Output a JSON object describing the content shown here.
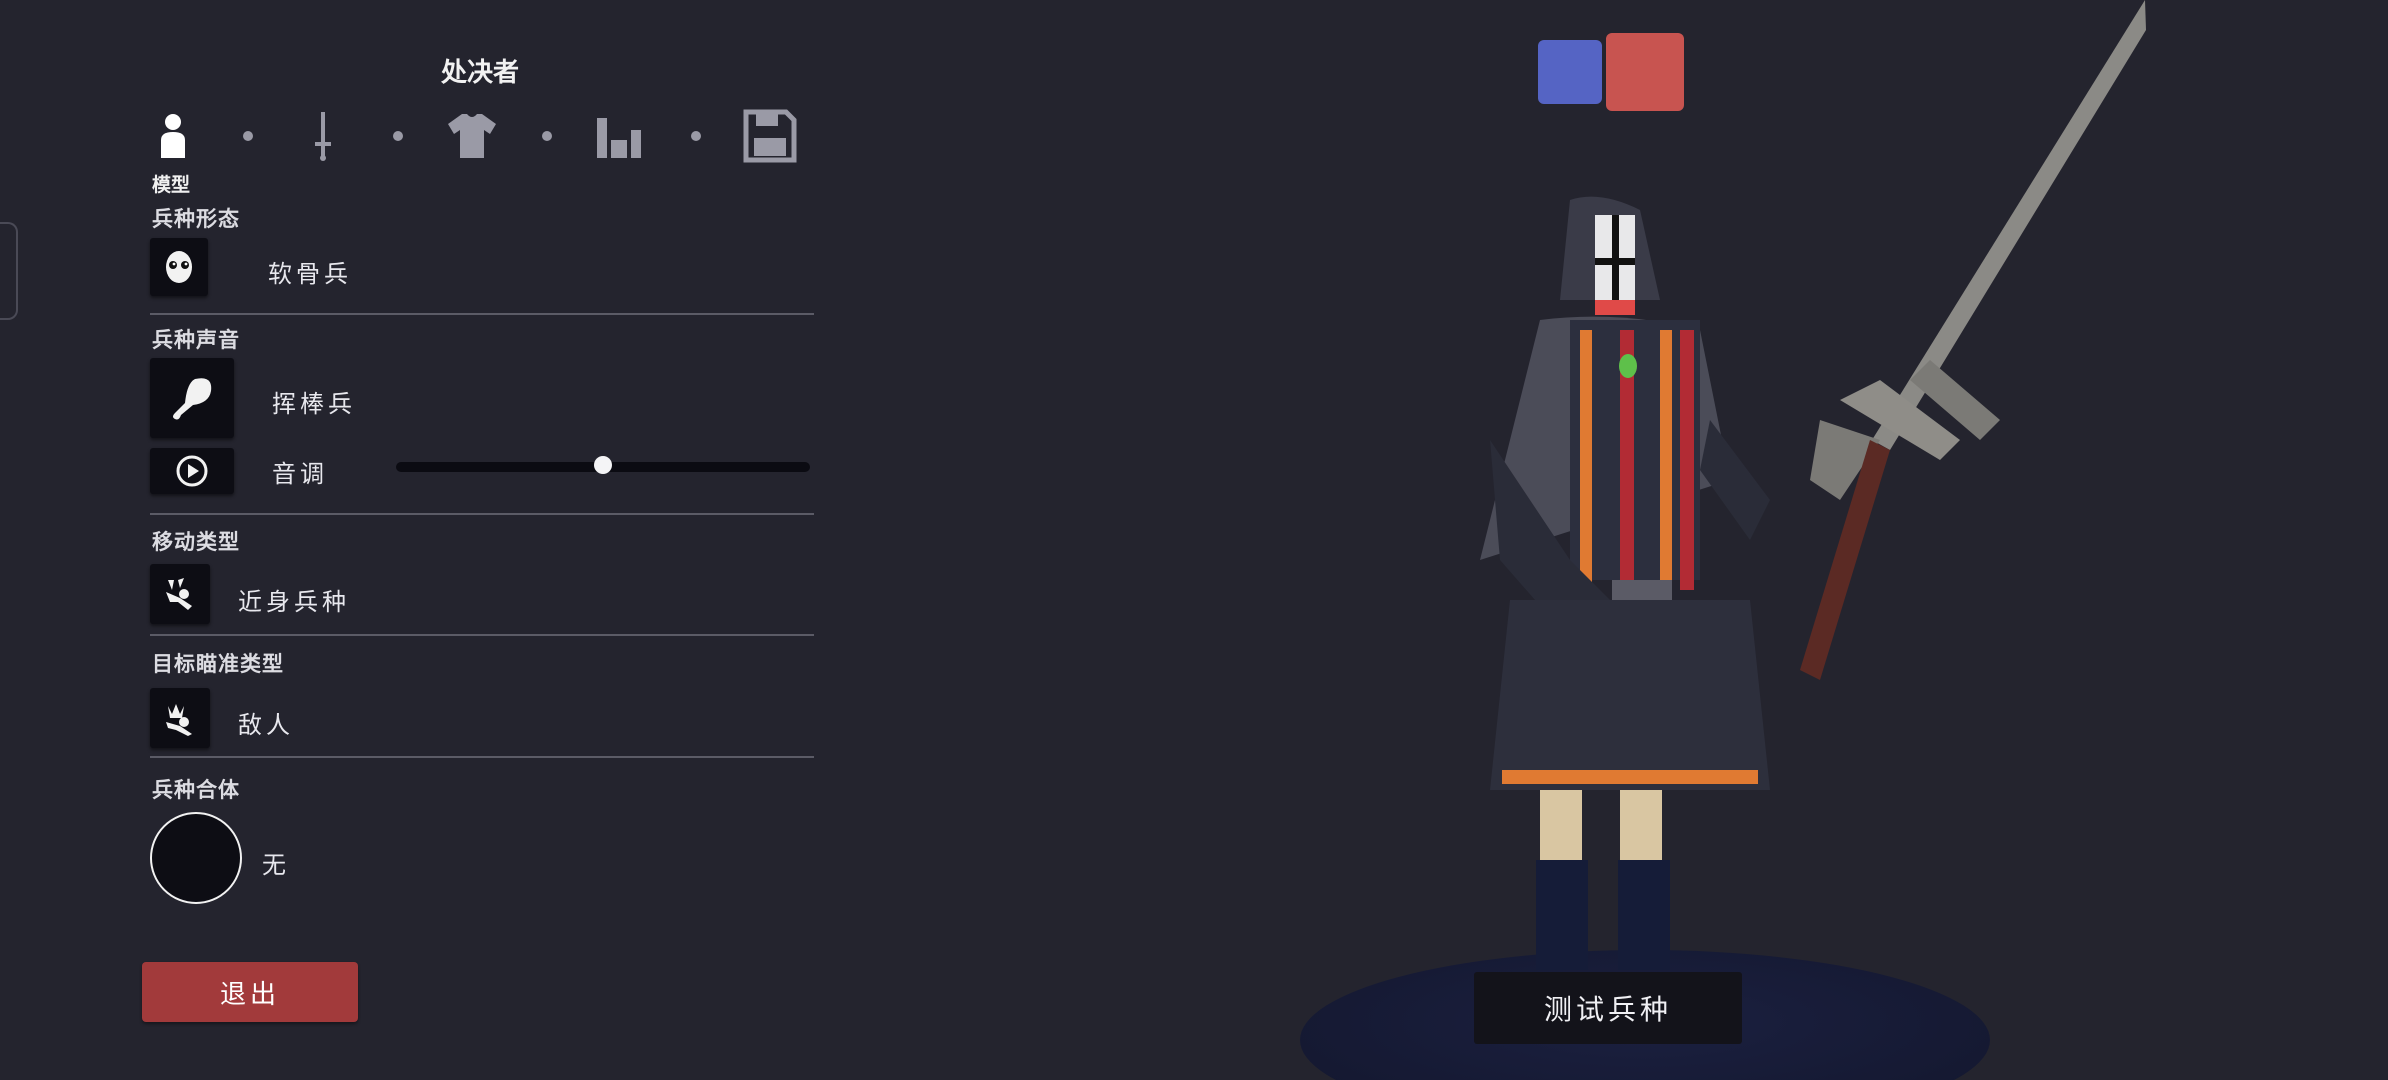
{
  "header": {
    "title": "处决者"
  },
  "tabs": [
    {
      "icon": "person-icon",
      "label": "模型"
    },
    {
      "icon": "sword-icon"
    },
    {
      "icon": "shirt-icon"
    },
    {
      "icon": "bar-chart-icon"
    },
    {
      "icon": "save-disk-icon"
    }
  ],
  "sections": {
    "form": {
      "label": "兵种形态",
      "value": "软骨兵",
      "icon": "skull-face-icon"
    },
    "voice": {
      "label": "兵种声音",
      "value": "挥棒兵",
      "icon": "drumstick-icon",
      "pitch_label": "音调",
      "pitch_level": 0.5
    },
    "movement": {
      "label": "移动类型",
      "value": "近身兵种",
      "icon": "running-figure-icon"
    },
    "targeting": {
      "label": "目标瞄准类型",
      "value": "敌人",
      "icon": "crown-figure-icon"
    },
    "merge": {
      "label": "兵种合体",
      "value": "无"
    }
  },
  "buttons": {
    "exit": "退出",
    "test_unit": "测试兵种"
  },
  "team_colors": {
    "blue": "#5564c4",
    "red": "#c85450"
  },
  "colors": {
    "accent_exit": "#a23a3b",
    "background": "#24242e"
  }
}
